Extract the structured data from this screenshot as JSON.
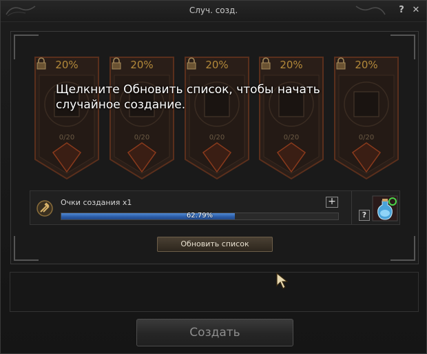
{
  "window": {
    "title": "Случ. созд.",
    "help_label": "?",
    "close_label": "✕"
  },
  "cards": [
    {
      "percent": "20%",
      "count": "0/20"
    },
    {
      "percent": "20%",
      "count": "0/20"
    },
    {
      "percent": "20%",
      "count": "0/20"
    },
    {
      "percent": "20%",
      "count": "0/20"
    },
    {
      "percent": "20%",
      "count": "0/20"
    }
  ],
  "instruction": "Щелкните Обновить список, чтобы начать случайное создание.",
  "points": {
    "label": "Очки создания x1",
    "plus_label": "+",
    "progress_text": "62.79%",
    "progress_value": 62.79,
    "help_label": "?"
  },
  "buttons": {
    "refresh": "Обновить список",
    "create": "Создать"
  },
  "colors": {
    "accent_gold": "#b3893a",
    "progress_blue": "#2a5aa5",
    "card_border": "#5a2f1c"
  },
  "icons": {
    "card_lock": "lock-icon",
    "points": "hammer-icon",
    "potion": "potion-icon",
    "cursor": "cursor-icon"
  }
}
